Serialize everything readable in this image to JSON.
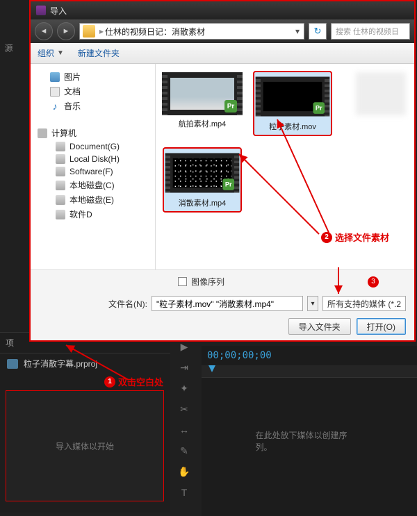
{
  "dialog": {
    "title": "导入",
    "path_text": "仕林的视频日记：消散素材",
    "search_placeholder": "搜索 仕林的视频日",
    "toolbar": {
      "organize": "组织",
      "new_folder": "新建文件夹"
    },
    "tree": {
      "pictures": "图片",
      "documents": "文档",
      "music": "音乐",
      "computer": "计算机",
      "drives": [
        "Document(G)",
        "Local Disk(H)",
        "Software(F)",
        "本地磁盘(C)",
        "本地磁盘(E)",
        "软件D"
      ]
    },
    "files": [
      {
        "name": "航拍素材.mp4",
        "thumb": "sky",
        "selected": false
      },
      {
        "name": "粒子素材.mov",
        "thumb": "black",
        "selected": true
      },
      {
        "name": "消散素材.mp4",
        "thumb": "noise",
        "selected": true
      }
    ],
    "image_sequence": "图像序列",
    "filename_label": "文件名(N):",
    "filename_value": "\"粒子素材.mov\" \"消散素材.mp4\"",
    "filetype": "所有支持的媒体 (*.2",
    "import_folder": "导入文件夹",
    "open": "打开(O)"
  },
  "project": {
    "tab": "项",
    "filename": "粒子消散字幕.prproj",
    "drop_placeholder": "导入媒体以开始"
  },
  "timeline": {
    "timecode": "00;00;00;00",
    "placeholder": "在此处放下媒体以创建序列。"
  },
  "sidebar": {
    "source": "源"
  },
  "annotations": {
    "a1": "双击空白处",
    "a2": "选择文件素材"
  }
}
